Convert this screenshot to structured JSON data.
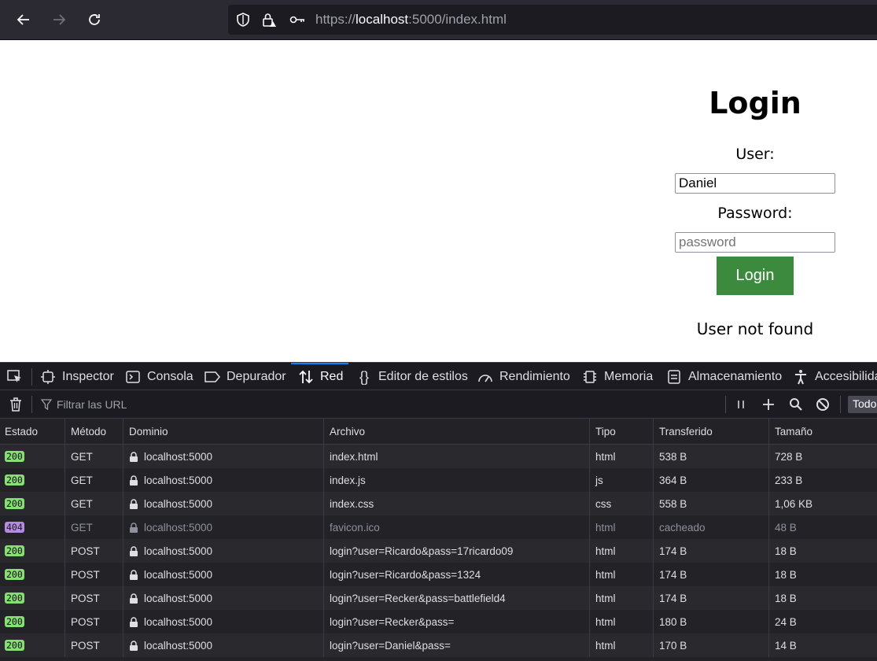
{
  "browser": {
    "url_prefix": "https://",
    "url_host": "localhost",
    "url_suffix": ":5000/index.html"
  },
  "page": {
    "title": "Login",
    "user_label": "User:",
    "user_value": "Daniel",
    "password_label": "Password:",
    "password_placeholder": "password",
    "login_button": "Login",
    "message": "User not found"
  },
  "devtools": {
    "tabs": [
      {
        "label": "Inspector",
        "icon": "inspector-icon"
      },
      {
        "label": "Consola",
        "icon": "console-icon"
      },
      {
        "label": "Depurador",
        "icon": "debugger-icon"
      },
      {
        "label": "Red",
        "icon": "network-icon",
        "active": true
      },
      {
        "label": "Editor de estilos",
        "icon": "style-editor-icon"
      },
      {
        "label": "Rendimiento",
        "icon": "performance-icon"
      },
      {
        "label": "Memoria",
        "icon": "memory-icon"
      },
      {
        "label": "Almacenamiento",
        "icon": "storage-icon"
      },
      {
        "label": "Accesibilidad",
        "icon": "accessibility-icon"
      }
    ],
    "filter_placeholder": "Filtrar las URL",
    "todo_label": "Todo",
    "columns": [
      "Estado",
      "Método",
      "Dominio",
      "Archivo",
      "Tipo",
      "Transferido",
      "Tamaño"
    ],
    "rows": [
      {
        "status": "200",
        "method": "GET",
        "domain": "localhost:5000",
        "file": "index.html",
        "type": "html",
        "transferred": "538 B",
        "size": "728 B"
      },
      {
        "status": "200",
        "method": "GET",
        "domain": "localhost:5000",
        "file": "index.js",
        "type": "js",
        "transferred": "364 B",
        "size": "233 B"
      },
      {
        "status": "200",
        "method": "GET",
        "domain": "localhost:5000",
        "file": "index.css",
        "type": "css",
        "transferred": "558 B",
        "size": "1,06 KB"
      },
      {
        "status": "404",
        "method": "GET",
        "domain": "localhost:5000",
        "file": "favicon.ico",
        "type": "html",
        "transferred": "cacheado",
        "size": "48 B",
        "dim": true
      },
      {
        "status": "200",
        "method": "POST",
        "domain": "localhost:5000",
        "file": "login?user=Ricardo&pass=17ricardo09",
        "type": "html",
        "transferred": "174 B",
        "size": "18 B"
      },
      {
        "status": "200",
        "method": "POST",
        "domain": "localhost:5000",
        "file": "login?user=Ricardo&pass=1324",
        "type": "html",
        "transferred": "174 B",
        "size": "18 B"
      },
      {
        "status": "200",
        "method": "POST",
        "domain": "localhost:5000",
        "file": "login?user=Recker&pass=battlefield4",
        "type": "html",
        "transferred": "174 B",
        "size": "18 B"
      },
      {
        "status": "200",
        "method": "POST",
        "domain": "localhost:5000",
        "file": "login?user=Recker&pass=",
        "type": "html",
        "transferred": "180 B",
        "size": "24 B"
      },
      {
        "status": "200",
        "method": "POST",
        "domain": "localhost:5000",
        "file": "login?user=Daniel&pass=",
        "type": "html",
        "transferred": "170 B",
        "size": "14 B"
      }
    ],
    "colors": {
      "ok": "#86de74",
      "not_found": "#b58ce0",
      "active_tab": "#0a84ff"
    }
  }
}
